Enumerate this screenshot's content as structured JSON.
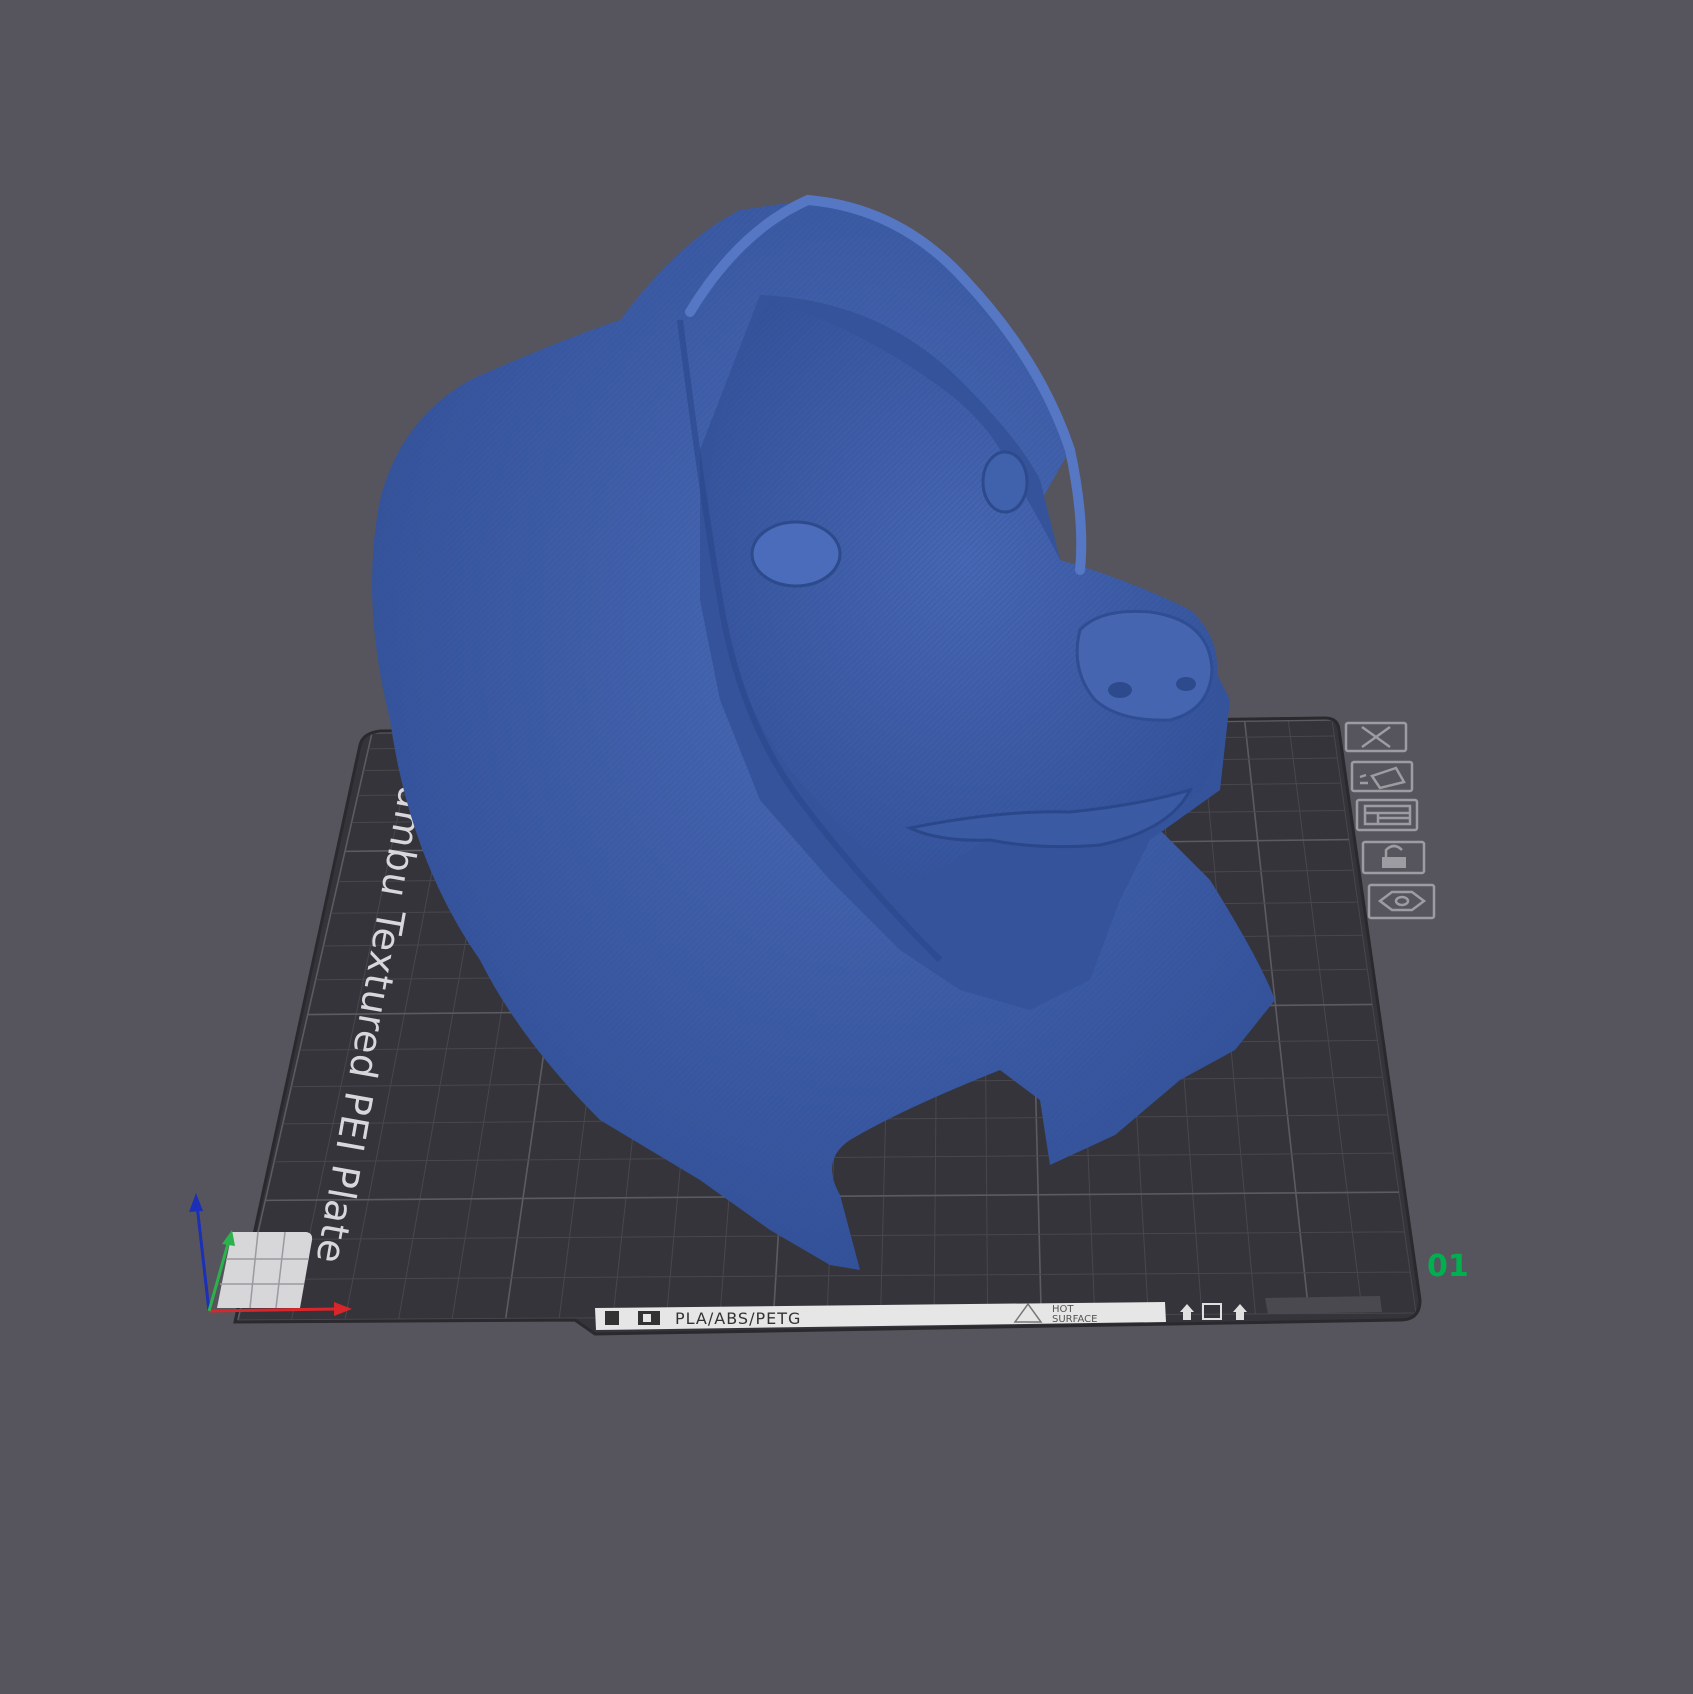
{
  "viewport": {
    "background": "#56555d",
    "model_color": "#3e5ea7"
  },
  "plate": {
    "name_label": "Bambu Textured PEI Plate",
    "plate_number": "01",
    "plate_number_color": "#00b050",
    "bottom_strip": {
      "material_label": "PLA/ABS/PETG",
      "hot_label_line1": "HOT",
      "hot_label_line2": "SURFACE"
    }
  },
  "plate_toolbar": [
    {
      "name": "delete-plate-button",
      "icon": "close-icon"
    },
    {
      "name": "arrange-plate-button",
      "icon": "arrange-icon"
    },
    {
      "name": "plate-settings-button",
      "icon": "layout-icon"
    },
    {
      "name": "lock-plate-button",
      "icon": "lock-icon"
    },
    {
      "name": "plate-view-button",
      "icon": "eye-icon"
    }
  ],
  "axes": {
    "x_color": "#d9262b",
    "y_color": "#2bb24c",
    "z_color": "#1b2fb8"
  }
}
